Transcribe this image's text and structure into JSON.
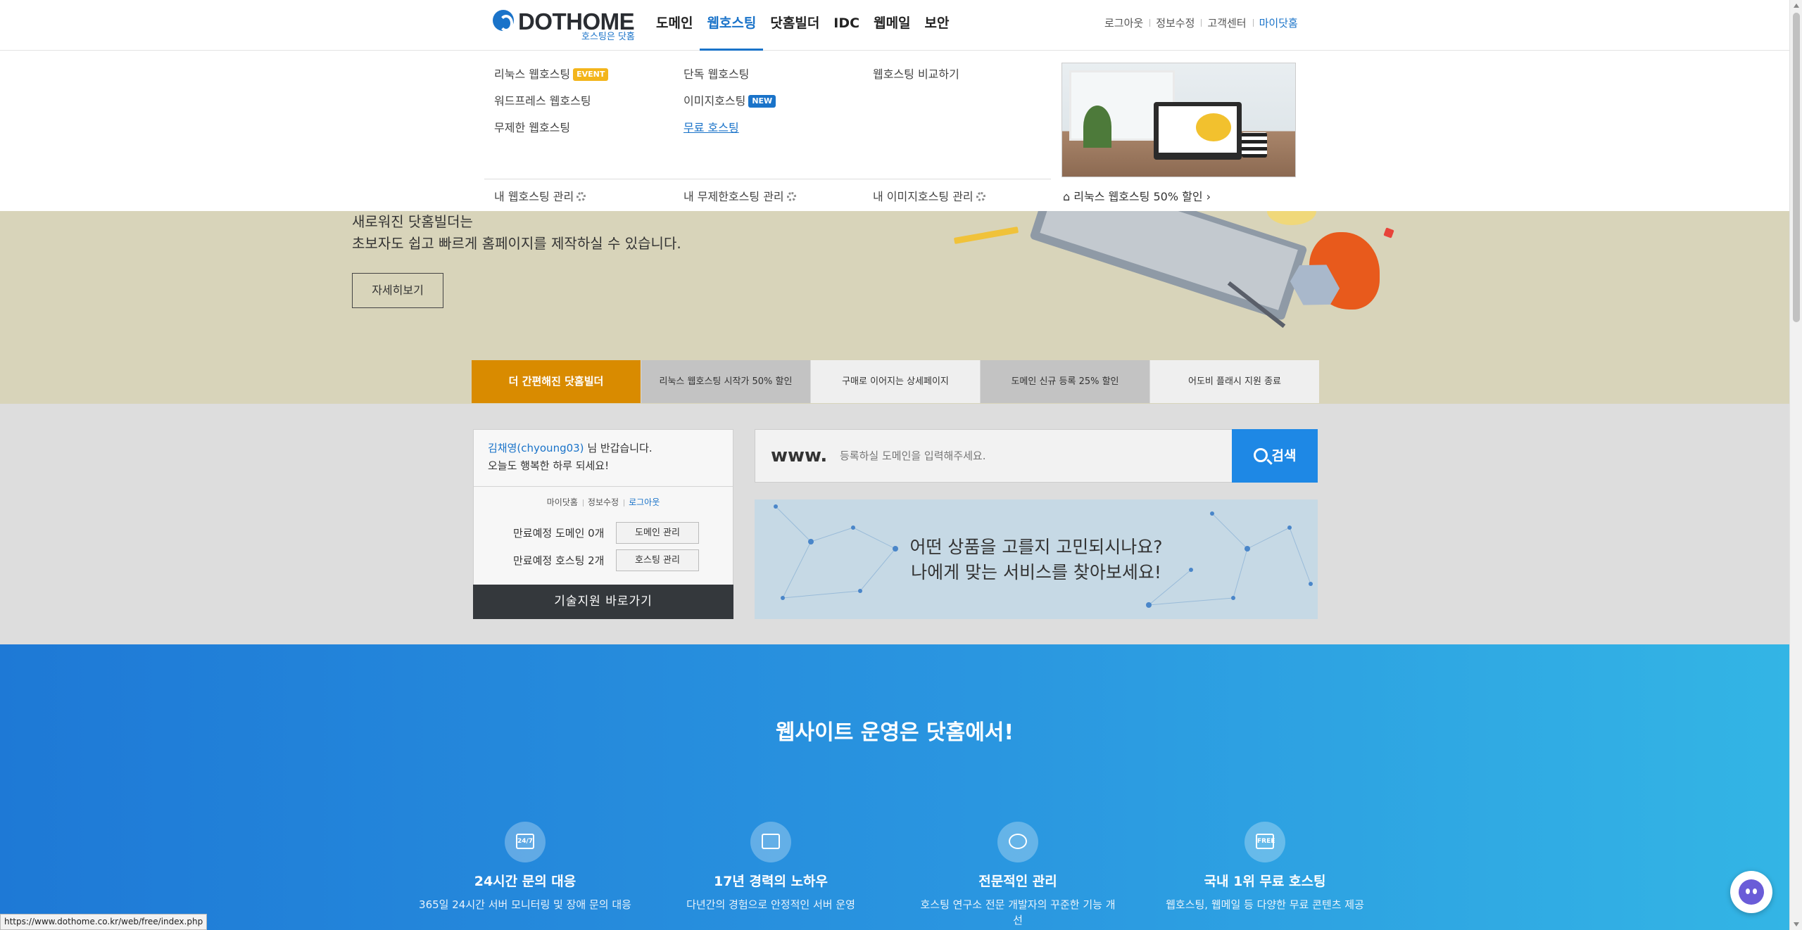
{
  "header": {
    "logo_text": "DOTHOME",
    "logo_sub": "호스팅은 닷홈",
    "nav": [
      "도메인",
      "웹호스팅",
      "닷홈빌더",
      "IDC",
      "웹메일",
      "보안"
    ],
    "nav_active": "웹호스팅",
    "util": [
      "로그아웃",
      "정보수정",
      "고객센터",
      "마이닷홈"
    ]
  },
  "mega_menu": {
    "col1": [
      {
        "label": "리눅스 웹호스팅",
        "badge": "EVENT"
      },
      {
        "label": "워드프레스 웹호스팅"
      },
      {
        "label": "무제한 웹호스팅"
      }
    ],
    "col2": [
      {
        "label": "단독 웹호스팅"
      },
      {
        "label": "이미지호스팅",
        "badge": "NEW"
      },
      {
        "label": "무료 호스팅"
      }
    ],
    "col3": [
      {
        "label": "웹호스팅 비교하기"
      }
    ],
    "manage": [
      "내 웹호스팅 관리",
      "내 무제한호스팅 관리",
      "내 이미지호스팅 관리"
    ],
    "promo_caption": "리눅스 웹호스팅 50% 할인 ›"
  },
  "hero": {
    "line1": "새로워진 닷홈빌더는",
    "line2": "초보자도 쉽고 빠르게 홈페이지를 제작하실 수 있습니다.",
    "button": "자세히보기"
  },
  "tabs": [
    "더 간편해진 닷홈빌더",
    "리눅스 웹호스팅 시작가 50% 할인",
    "구매로 이어지는 상세페이지",
    "도메인 신규 등록 25% 할인",
    "어도비 플래시 지원 종료"
  ],
  "user_box": {
    "name": "김채영(chyoung03)",
    "greet_suffix": " 님 반갑습니다.",
    "greet_line2": "오늘도 행복한 하루 되세요!",
    "links": [
      "마이닷홈",
      "정보수정",
      "로그아웃"
    ],
    "domain_row": "만료예정 도메인 0개",
    "domain_btn": "도메인 관리",
    "hosting_row": "만료예정 호스팅 2개",
    "hosting_btn": "호스팅 관리",
    "tech_btn": "기술지원  바로가기"
  },
  "search": {
    "prefix": "www.",
    "placeholder": "등록하실 도메인을 입력해주세요.",
    "button": "검색"
  },
  "banner": {
    "line1": "어떤 상품을 고를지 고민되시나요?",
    "line2": "나에게 맞는 서비스를 찾아보세요!"
  },
  "feature": {
    "title": "웹사이트 운영은 닷홈에서!",
    "items": [
      {
        "icon": "24-7-icon",
        "glyph": "24/7",
        "title": "24시간 문의 대응",
        "desc": "365일 24시간 서버 모니터링 및 장애 문의 대응"
      },
      {
        "icon": "experience-icon",
        "glyph": "",
        "title": "17년 경력의 노하우",
        "desc": "다년간의 경험으로 안정적인 서버 운영"
      },
      {
        "icon": "expert-icon",
        "glyph": "",
        "title": "전문적인 관리",
        "desc": "호스팅 연구소 전문 개발자의 꾸준한 기능 개선"
      },
      {
        "icon": "free-icon",
        "glyph": "FREE",
        "title": "국내 1위 무료 호스팅",
        "desc": "웹호스팅, 웹메일 등 다양한 무료 콘텐츠 제공"
      }
    ]
  },
  "status_url": "https://www.dothome.co.kr/web/free/index.php",
  "colors": {
    "brand": "#1a73c9",
    "tab_active": "#d98b00",
    "search_button": "#1e88e5",
    "hero_bg": "#d8d4ba"
  }
}
